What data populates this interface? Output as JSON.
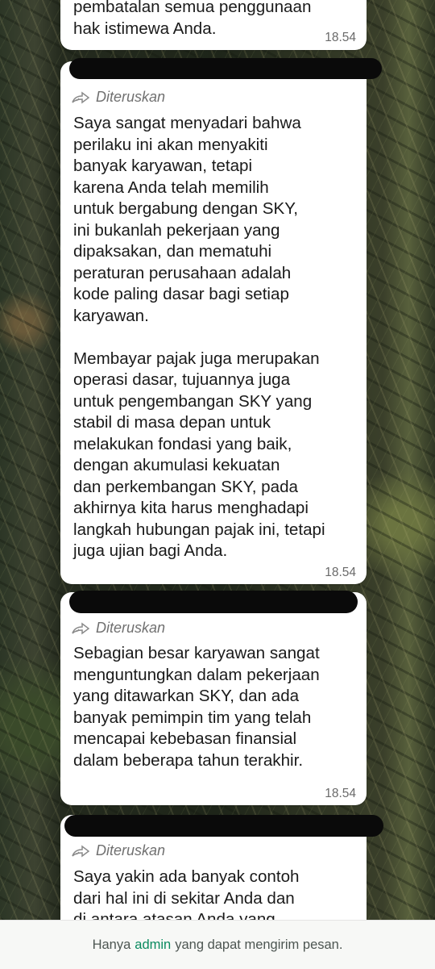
{
  "messages": [
    {
      "text": "pembatalan semua penggunaan\nhak istimewa Anda.",
      "time": "18.54"
    },
    {
      "forwarded_label": "Diteruskan",
      "text": "Saya sangat menyadari bahwa\nperilaku ini akan menyakiti\nbanyak karyawan, tetapi\nkarena Anda telah memilih\nuntuk bergabung dengan SKY,\nini bukanlah pekerjaan yang\ndipaksakan, dan mematuhi\nperaturan perusahaan adalah\nkode paling dasar bagi setiap\nkaryawan.\n\nMembayar pajak juga merupakan\noperasi dasar, tujuannya juga\nuntuk pengembangan SKY yang\nstabil di masa depan untuk\nmelakukan fondasi yang baik,\ndengan akumulasi kekuatan\ndan perkembangan SKY, pada\nakhirnya kita harus menghadapi\nlangkah hubungan pajak ini, tetapi\njuga ujian bagi Anda.",
      "time": "18.54"
    },
    {
      "sender_partial": "+^ ^^^ ^^^^ ^^^^",
      "forwarded_label": "Diteruskan",
      "text": "Sebagian besar karyawan sangat\nmenguntungkan dalam pekerjaan\nyang ditawarkan SKY, dan ada\nbanyak pemimpin tim yang telah\nmencapai kebebasan finansial\ndalam beberapa tahun terakhir.",
      "time": "18.54"
    },
    {
      "forwarded_label": "Diteruskan",
      "text": "Saya yakin ada banyak contoh\ndari hal ini di sekitar Anda dan\ndi antara atasan Anda yang"
    }
  ],
  "footer": {
    "prefix": "Hanya",
    "admin": "admin",
    "suffix": "yang dapat mengirim pesan."
  },
  "icons": {
    "forward": "forward-arrow-icon"
  },
  "colors": {
    "bubble": "#ffffff",
    "admin_link": "#0a8a5f",
    "footer_bg": "#f7f8f6"
  }
}
